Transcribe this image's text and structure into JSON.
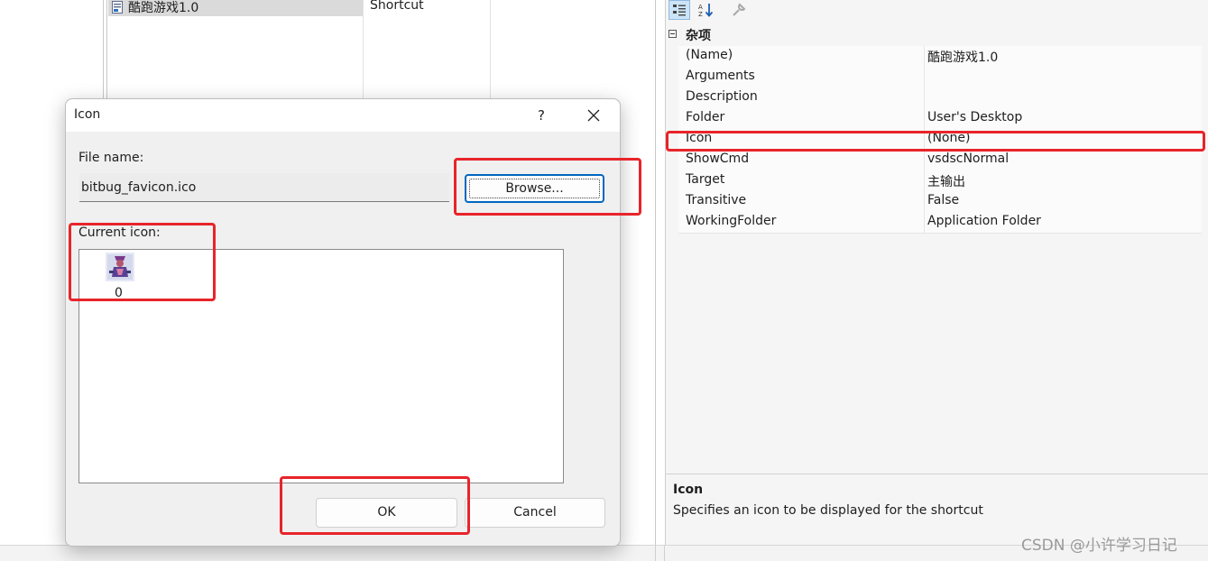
{
  "file_list": {
    "row_name": "酷跑游戏1.0",
    "row_type": "Shortcut"
  },
  "properties": {
    "category": "杂项",
    "rows": [
      {
        "name": "(Name)",
        "value": "酷跑游戏1.0"
      },
      {
        "name": "Arguments",
        "value": ""
      },
      {
        "name": "Description",
        "value": ""
      },
      {
        "name": "Folder",
        "value": "User's Desktop"
      },
      {
        "name": "Icon",
        "value": "(None)"
      },
      {
        "name": "ShowCmd",
        "value": "vsdscNormal"
      },
      {
        "name": "Target",
        "value": "主输出"
      },
      {
        "name": "Transitive",
        "value": "False"
      },
      {
        "name": "WorkingFolder",
        "value": "Application Folder"
      }
    ],
    "description_title": "Icon",
    "description_text": "Specifies an icon to be displayed for the shortcut"
  },
  "dialog": {
    "title": "Icon",
    "help_label": "?",
    "file_name_label": "File name:",
    "file_name_value": "bitbug_favicon.ico",
    "browse_label": "Browse...",
    "current_icon_label": "Current icon:",
    "icon_index": "0",
    "ok_label": "OK",
    "cancel_label": "Cancel"
  },
  "watermark": "CSDN @小许学习日记",
  "annotation_color": "#e8242a"
}
